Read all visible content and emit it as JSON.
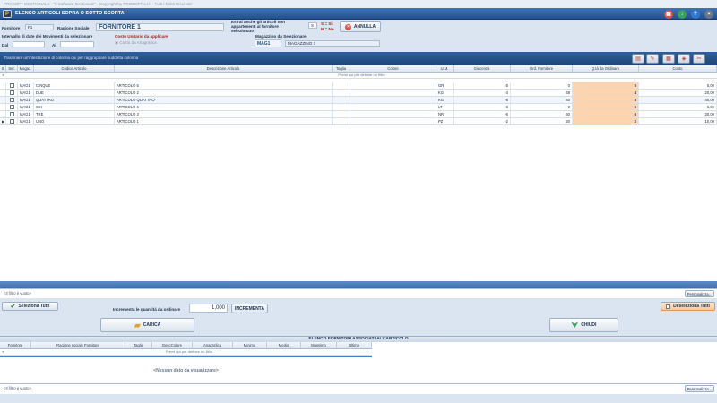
{
  "window": {
    "title": "PROSOFT GESTIONALE - \"Il Software Gestionale\" - Copyright by PROSOFT s.r.l. - Tutti i Diritti Riservati",
    "app_title": "ELENCO ARTICOLI SOPRA O SOTTO SCORTA"
  },
  "filters": {
    "fornitore_label": "Fornitore",
    "fornitore_code": "F1",
    "ragione_sociale_label": "Ragione Sociale",
    "ragione_sociale_value": "FORNITORE 1",
    "intervallo_label": "Intervallo di date dei Movimenti da selezionare",
    "dal_label": "Dal",
    "al_label": "Al",
    "costo_label": "Costo Unitario da applicare",
    "costo_option": "Costo da Anagrafica",
    "estrai_label": "Estrai anche gli articoli non appartenenti al fornitore selezionato",
    "estrai_value": "S",
    "sn_yes": "S = Si",
    "sn_no": "N = No",
    "annulla_label": "ANNULLA",
    "magazzino_label": "Magazzino da Selezionare",
    "magazzino_code": "MAG1",
    "magazzino_name": "MAGAZZINO 1"
  },
  "toolbar": {
    "group_hint": "Trascinare un'intestazione di colonna qui per raggruppare suddetta colonna"
  },
  "table": {
    "columns": [
      "S",
      "Sel.",
      "Magaz.",
      "Codice Articolo",
      "Descrizione Articolo",
      "Taglia",
      "Colore",
      "U.M.",
      "Giacenza",
      "Ord. Fornitore",
      "Q.tà da Ordinare",
      "Costo"
    ],
    "filter_placeholder": "Premi qui per definire un filtro",
    "rows": [
      {
        "mag": "MAG1",
        "codice": "CINQUE",
        "descr": "ARTICOLO 5",
        "taglia": "",
        "colore": "",
        "um": "GR",
        "giacenza": "-5",
        "ordf": "0",
        "qta": "5",
        "costo": "5,00"
      },
      {
        "mag": "MAG1",
        "codice": "DUE",
        "descr": "ARTICOLO 2",
        "taglia": "",
        "colore": "",
        "um": "KG",
        "giacenza": "-4",
        "ordf": "48",
        "qta": "4",
        "costo": "20,00"
      },
      {
        "mag": "MAG1",
        "codice": "QUATTRO",
        "descr": "ARTICOLO QUATTRO",
        "taglia": "",
        "colore": "",
        "um": "KG",
        "giacenza": "-8",
        "ordf": "40",
        "qta": "8",
        "costo": "40,00"
      },
      {
        "mag": "MAG1",
        "codice": "SEI",
        "descr": "ARTICOLO 6",
        "taglia": "",
        "colore": "",
        "um": "LT",
        "giacenza": "-6",
        "ordf": "0",
        "qta": "6",
        "costo": "6,00"
      },
      {
        "mag": "MAG1",
        "codice": "TRE",
        "descr": "ARTICOLO 3",
        "taglia": "",
        "colore": "",
        "um": "NR",
        "giacenza": "-6",
        "ordf": "60",
        "qta": "6",
        "costo": "30,00"
      },
      {
        "mag": "MAG1",
        "codice": "UNO",
        "descr": "ARTICOLO 1",
        "taglia": "",
        "colore": "",
        "um": "PZ",
        "giacenza": "-2",
        "ordf": "20",
        "qta": "2",
        "costo": "10,00"
      }
    ],
    "filter_status": "<Il filtro è vuoto>",
    "personalizza": "Personalizza..."
  },
  "actions": {
    "seleziona_tutti": "Seleziona Tutti",
    "incrementa_label": "Incrementa le quantità da ordinare",
    "incrementa_value": "1,000",
    "incrementa_btn": "INCREMENTA",
    "deseleziona_tutti": "Deseleziona Tutti",
    "carica": "CARICA",
    "chiudi": "CHIUDI"
  },
  "suppliers": {
    "title": "ELENCO FORNITORI ASSOCIATI ALL'ARTICOLO",
    "columns": [
      "Fornitore",
      "Ragione sociale Fornitore",
      "Taglia",
      "DescColore",
      "Anagrafica",
      "Minimo",
      "Medio",
      "Massimo",
      "Ultimo"
    ],
    "filter_placeholder": "Premi qui per definire un filtro",
    "empty_message": "<Nessun dato da visualizzare>",
    "filter_status": "<Il filtro è vuoto>",
    "personalizza": "Personalizza..."
  },
  "colors": {
    "header_blue": "#2e5f9e",
    "qty_highlight": "#fbd4b0",
    "btn_red": "#d9534f",
    "btn_green": "#3aa05a",
    "btn_blue": "#2f7ad0"
  }
}
